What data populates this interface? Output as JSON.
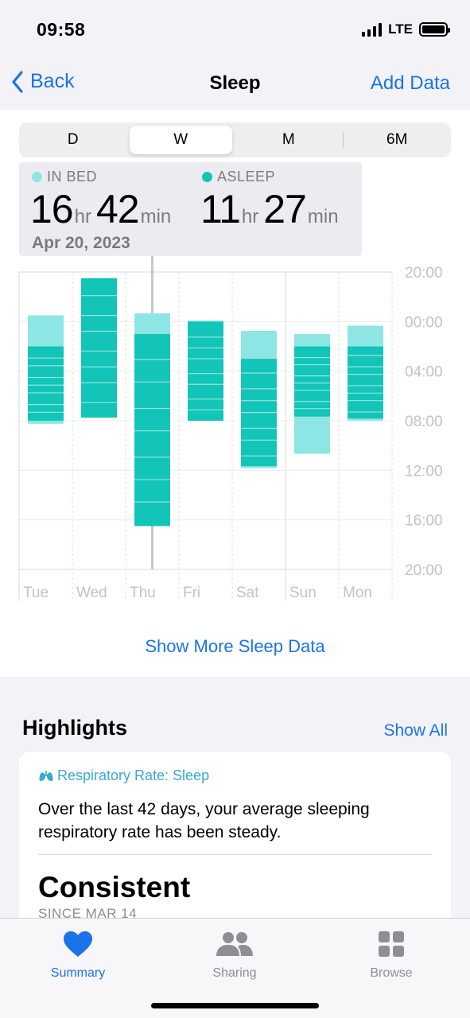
{
  "status": {
    "time": "09:58",
    "network": "LTE"
  },
  "nav": {
    "back_label": "Back",
    "title": "Sleep",
    "add_label": "Add Data"
  },
  "segments": [
    {
      "label": "D",
      "active": false
    },
    {
      "label": "W",
      "active": true
    },
    {
      "label": "M",
      "active": false
    },
    {
      "label": "6M",
      "active": false
    }
  ],
  "tooltip": {
    "in_bed_label": "IN BED",
    "asleep_label": "ASLEEP",
    "in_bed_hr": "16",
    "in_bed_min": "42",
    "asleep_hr": "11",
    "asleep_min": "27",
    "hr_unit": "hr",
    "min_unit": "min",
    "date": "Apr 20, 2023"
  },
  "colors": {
    "accent": "#1a73e8",
    "in_bed": "#8ee6e4",
    "asleep": "#13c4b8"
  },
  "chart_data": {
    "type": "bar",
    "categories": [
      "Tue",
      "Wed",
      "Thu",
      "Fri",
      "Sat",
      "Sun",
      "Mon"
    ],
    "y_tick_labels": [
      "20:00",
      "00:00",
      "04:00",
      "08:00",
      "12:00",
      "16:00",
      "20:00"
    ],
    "y_range_hours": [
      20,
      44
    ],
    "selected_category": "Thu",
    "series": [
      {
        "name": "IN BED",
        "ranges": [
          [
            "23:30",
            "08:15"
          ],
          [
            "20:30",
            "07:45"
          ],
          [
            "23:20",
            "16:30"
          ],
          [
            "23:55",
            "08:00"
          ],
          [
            "00:45",
            "11:50"
          ],
          [
            "01:00",
            "10:40"
          ],
          [
            "00:20",
            "08:00"
          ]
        ]
      },
      {
        "name": "ASLEEP",
        "ranges": [
          [
            "02:00",
            "08:00"
          ],
          [
            "20:30",
            "07:45"
          ],
          [
            "01:00",
            "16:30"
          ],
          [
            "00:00",
            "08:00"
          ],
          [
            "03:00",
            "11:40"
          ],
          [
            "02:00",
            "07:40"
          ],
          [
            "02:00",
            "07:50"
          ]
        ]
      }
    ]
  },
  "show_more_label": "Show More Sleep Data",
  "highlights": {
    "title": "Highlights",
    "show_all": "Show All",
    "category": "Respiratory Rate: Sleep",
    "text": "Over the last 42 days, your average sleeping respiratory rate has been steady.",
    "value": "Consistent",
    "since": "SINCE MAR 14"
  },
  "tabs": [
    {
      "label": "Summary",
      "icon": "heart-icon",
      "active": true
    },
    {
      "label": "Sharing",
      "icon": "people-icon",
      "active": false
    },
    {
      "label": "Browse",
      "icon": "grid-icon",
      "active": false
    }
  ]
}
